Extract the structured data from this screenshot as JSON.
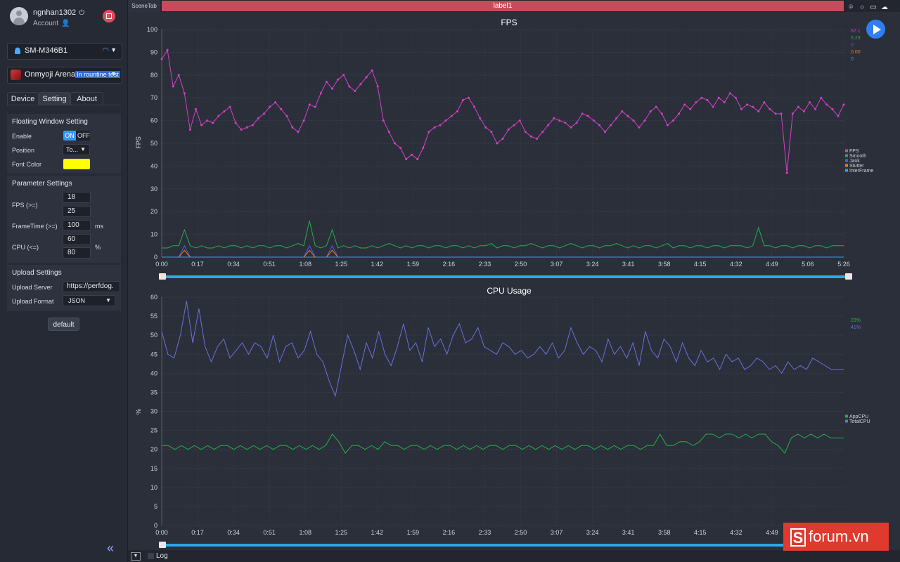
{
  "user": {
    "name": "ngnhan1302",
    "account_label": "Account"
  },
  "device": {
    "name": "SM-M346B1"
  },
  "app": {
    "name": "Onmyoji Arena",
    "badge": "In rountine test"
  },
  "tabs": [
    "Device",
    "Setting",
    "About"
  ],
  "active_tab": "Setting",
  "floating_window": {
    "title": "Floating Window Setting",
    "enable_label": "Enable",
    "on_label": "ON",
    "off_label": "OFF",
    "position_label": "Position",
    "position_value": "To...",
    "font_color_label": "Font Color",
    "font_color": "#ffff00"
  },
  "parameter_settings": {
    "title": "Parameter Settings",
    "fps_label": "FPS (>=)",
    "fps_values": [
      "18",
      "25"
    ],
    "frametime_label": "FrameTime (>=)",
    "frametime_value": "100",
    "frametime_unit": "ms",
    "cpu_label": "CPU (<=)",
    "cpu_values": [
      "60",
      "80"
    ],
    "cpu_unit": "%"
  },
  "upload_settings": {
    "title": "Upload Settings",
    "server_label": "Upload Server",
    "server_value": "https://perfdog.",
    "format_label": "Upload Format",
    "format_value": "JSON"
  },
  "default_button": "default",
  "scene": {
    "tab_label": "SceneTab",
    "label": "label1"
  },
  "bottom": {
    "log_label": "Log"
  },
  "watermark": {
    "letter": "S",
    "text": "forum.vn"
  },
  "colors": {
    "accent": "#2f7ff0",
    "fps": "#d63fc8",
    "smooth": "#22b04a",
    "jank": "#4a5ee0",
    "stutter": "#ff7a00",
    "interframe": "#35a0e0",
    "appcpu": "#22b04a",
    "totalcpu": "#6a70d8",
    "scene_label": "#c44d5c"
  },
  "icons": [
    "power-icon",
    "user-settings-icon",
    "record-stop-icon",
    "android-icon",
    "wifi-icon",
    "chevron-down-icon",
    "location-pin-icon",
    "marker-icon",
    "folder-icon",
    "cloud-icon",
    "play-icon",
    "collapse-double-chevron-icon"
  ],
  "chart_data": [
    {
      "type": "line",
      "title": "FPS",
      "ylabel": "FPS",
      "ylim": [
        0,
        100
      ],
      "yticks": [
        0,
        10,
        20,
        30,
        40,
        50,
        60,
        70,
        80,
        90,
        100
      ],
      "xticks": [
        "0:00",
        "0:17",
        "0:34",
        "0:51",
        "1:08",
        "1:25",
        "1:42",
        "1:59",
        "2:16",
        "2:33",
        "2:50",
        "3:07",
        "3:24",
        "3:41",
        "3:58",
        "4:15",
        "4:32",
        "4:49",
        "5:06",
        "5:26"
      ],
      "current_values": [
        "67.1",
        "5.23",
        "0",
        "0.00",
        "0"
      ],
      "series": [
        {
          "name": "FPS",
          "values": [
            87,
            91,
            75,
            80,
            72,
            56,
            65,
            58,
            60,
            59,
            62,
            64,
            66,
            59,
            56,
            57,
            58,
            61,
            63,
            66,
            68,
            65,
            62,
            57,
            55,
            60,
            67,
            66,
            72,
            77,
            74,
            78,
            80,
            75,
            73,
            76,
            79,
            82,
            75,
            60,
            55,
            50,
            48,
            43,
            45,
            43,
            48,
            55,
            57,
            58,
            60,
            62,
            64,
            69,
            70,
            66,
            61,
            57,
            55,
            50,
            52,
            56,
            58,
            60,
            55,
            53,
            52,
            55,
            58,
            61,
            60,
            59,
            57,
            59,
            63,
            62,
            60,
            58,
            55,
            58,
            61,
            64,
            62,
            60,
            57,
            60,
            64,
            66,
            63,
            58,
            60,
            63,
            67,
            65,
            68,
            70,
            69,
            66,
            70,
            68,
            72,
            70,
            65,
            67,
            66,
            64,
            68,
            65,
            63,
            63,
            37,
            63,
            66,
            64,
            68,
            65,
            70,
            67,
            65,
            62,
            67
          ]
        },
        {
          "name": "Smooth",
          "values": [
            4,
            4,
            5,
            5,
            12,
            5,
            4,
            5,
            4,
            4,
            5,
            4,
            5,
            5,
            4,
            5,
            4,
            5,
            5,
            4,
            5,
            5,
            4,
            5,
            6,
            5,
            16,
            5,
            4,
            5,
            12,
            4,
            5,
            4,
            5,
            4,
            4,
            5,
            4,
            5,
            6,
            5,
            4,
            5,
            4,
            5,
            5,
            4,
            5,
            5,
            4,
            5,
            5,
            4,
            5,
            4,
            5,
            5,
            6,
            4,
            5,
            5,
            4,
            5,
            5,
            6,
            5,
            4,
            5,
            5,
            4,
            5,
            6,
            5,
            4,
            5,
            5,
            4,
            5,
            5,
            6,
            5,
            4,
            5,
            4,
            5,
            5,
            4,
            5,
            6,
            4,
            5,
            5,
            4,
            5,
            5,
            4,
            5,
            5,
            4,
            5,
            5,
            5,
            4,
            5,
            13,
            5,
            5,
            4,
            5,
            5,
            4,
            5,
            5,
            4,
            5,
            5,
            4,
            5,
            5,
            5
          ]
        },
        {
          "name": "Jank",
          "values": [
            0,
            0,
            0,
            0,
            5,
            0,
            0,
            0,
            0,
            0,
            0,
            0,
            0,
            0,
            0,
            0,
            0,
            0,
            0,
            0,
            0,
            0,
            0,
            0,
            0,
            0,
            5,
            0,
            0,
            0,
            5,
            0,
            0,
            0,
            0,
            0,
            0,
            0,
            0,
            0,
            0,
            0,
            0,
            0,
            0,
            0,
            0,
            0,
            0,
            0,
            0,
            0,
            0,
            0,
            0,
            0,
            0,
            0,
            0,
            0,
            0,
            0,
            0,
            0,
            0,
            0,
            0,
            0,
            0,
            0,
            0,
            0,
            0,
            0,
            0,
            0,
            0,
            0,
            0,
            0,
            0,
            0,
            0,
            0,
            0,
            0,
            0,
            0,
            0,
            0,
            0,
            0,
            0,
            0,
            0,
            0,
            0,
            0,
            0,
            0,
            0,
            0,
            0,
            0,
            0,
            0,
            0,
            0,
            0,
            0,
            0,
            0,
            0,
            0,
            0,
            0,
            0,
            0,
            0,
            0,
            0
          ]
        },
        {
          "name": "Stutter",
          "values": [
            0,
            0,
            0,
            0,
            3,
            0,
            0,
            0,
            0,
            0,
            0,
            0,
            0,
            0,
            0,
            0,
            0,
            0,
            0,
            0,
            0,
            0,
            0,
            0,
            0,
            0,
            3,
            0,
            0,
            0,
            3,
            0,
            0,
            0,
            0,
            0,
            0,
            0,
            0,
            0,
            0,
            0,
            0,
            0,
            0,
            0,
            0,
            0,
            0,
            0,
            0,
            0,
            0,
            0,
            0,
            0,
            0,
            0,
            0,
            0,
            0,
            0,
            0,
            0,
            0,
            0,
            0,
            0,
            0,
            0,
            0,
            0,
            0,
            0,
            0,
            0,
            0,
            0,
            0,
            0,
            0,
            0,
            0,
            0,
            0,
            0,
            0,
            0,
            0,
            0,
            0,
            0,
            0,
            0,
            0,
            0,
            0,
            0,
            0,
            0,
            0,
            0,
            0,
            0,
            0,
            0,
            0,
            0,
            0,
            0,
            0,
            0,
            0,
            0,
            0,
            0,
            0,
            0,
            0,
            0,
            0
          ]
        },
        {
          "name": "InterFrame",
          "values": [
            0,
            0,
            0,
            0,
            0,
            0,
            0,
            0,
            0,
            0,
            0,
            0,
            0,
            0,
            0,
            0,
            0,
            0,
            0,
            0,
            0,
            0,
            0,
            0,
            0,
            0,
            0,
            0,
            0,
            0,
            0,
            0,
            0,
            0,
            0,
            0,
            0,
            0,
            0,
            0,
            0,
            0,
            0,
            0,
            0,
            0,
            0,
            0,
            0,
            0,
            0,
            0,
            0,
            0,
            0,
            0,
            0,
            0,
            0,
            0,
            0,
            0,
            0,
            0,
            0,
            0,
            0,
            0,
            0,
            0,
            0,
            0,
            0,
            0,
            0,
            0,
            0,
            0,
            0,
            0,
            0,
            0,
            0,
            0,
            0,
            0,
            0,
            0,
            0,
            0,
            0,
            0,
            0,
            0,
            0,
            0,
            0,
            0,
            0,
            0,
            0,
            0,
            0,
            0,
            0,
            0,
            0,
            0,
            0,
            0,
            0,
            0,
            0,
            0,
            0,
            0,
            0,
            0,
            0,
            0,
            0
          ]
        }
      ]
    },
    {
      "type": "line",
      "title": "CPU Usage",
      "ylabel": "%",
      "ylim": [
        0,
        60
      ],
      "yticks": [
        0,
        5,
        10,
        15,
        20,
        25,
        30,
        35,
        40,
        45,
        50,
        55,
        60
      ],
      "xticks": [
        "0:00",
        "0:17",
        "0:34",
        "0:51",
        "1:08",
        "1:25",
        "1:42",
        "1:59",
        "2:16",
        "2:33",
        "2:50",
        "3:07",
        "3:24",
        "3:41",
        "3:58",
        "4:15",
        "4:32",
        "4:49"
      ],
      "current_values": [
        "23%",
        "41%"
      ],
      "series": [
        {
          "name": "AppCPU",
          "values": [
            21,
            21,
            20,
            21,
            20,
            21,
            20,
            21,
            20,
            21,
            21,
            20,
            21,
            20,
            21,
            20,
            21,
            20,
            21,
            21,
            20,
            21,
            20,
            21,
            20,
            21,
            24,
            22,
            19,
            21,
            21,
            20,
            21,
            20,
            22,
            21,
            21,
            20,
            21,
            21,
            20,
            21,
            20,
            21,
            21,
            20,
            21,
            20,
            21,
            20,
            21,
            21,
            20,
            21,
            21,
            20,
            21,
            20,
            21,
            20,
            21,
            20,
            21,
            20,
            21,
            21,
            20,
            21,
            20,
            21,
            20,
            21,
            21,
            20,
            21,
            21,
            24,
            21,
            21,
            22,
            22,
            21,
            22,
            24,
            24,
            23,
            24,
            24,
            23,
            24,
            23,
            24,
            24,
            22,
            21,
            19,
            23,
            24,
            23,
            24,
            23,
            24,
            23,
            23,
            23
          ]
        },
        {
          "name": "TotalCPU",
          "values": [
            51,
            45,
            44,
            50,
            59,
            48,
            57,
            47,
            43,
            47,
            49,
            44,
            46,
            48,
            45,
            48,
            47,
            44,
            50,
            43,
            47,
            48,
            44,
            46,
            51,
            45,
            43,
            38,
            34,
            42,
            50,
            46,
            41,
            48,
            44,
            51,
            45,
            42,
            47,
            53,
            46,
            48,
            43,
            52,
            47,
            49,
            45,
            50,
            53,
            48,
            49,
            52,
            47,
            46,
            45,
            48,
            47,
            45,
            46,
            44,
            45,
            47,
            45,
            48,
            44,
            46,
            52,
            48,
            45,
            47,
            46,
            43,
            49,
            45,
            47,
            44,
            48,
            42,
            51,
            46,
            44,
            49,
            47,
            43,
            48,
            44,
            42,
            46,
            43,
            44,
            41,
            45,
            43,
            44,
            41,
            42,
            44,
            43,
            41,
            42,
            40,
            43,
            41,
            42,
            41,
            44,
            43,
            42,
            41,
            41,
            41
          ]
        }
      ]
    }
  ]
}
